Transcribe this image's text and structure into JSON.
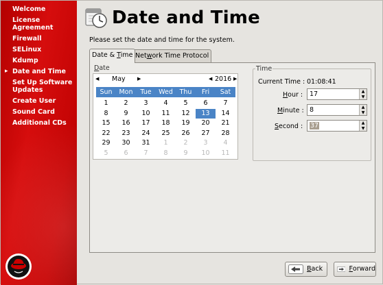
{
  "sidebar": {
    "items": [
      {
        "label": "Welcome"
      },
      {
        "label": "License Agreement"
      },
      {
        "label": "Firewall"
      },
      {
        "label": "SELinux"
      },
      {
        "label": "Kdump"
      },
      {
        "label": "Date and Time",
        "current": true
      },
      {
        "label": "Set Up Software Updates"
      },
      {
        "label": "Create User"
      },
      {
        "label": "Sound Card"
      },
      {
        "label": "Additional CDs"
      }
    ],
    "current_marker": "▸"
  },
  "header": {
    "title": "Date and Time",
    "instructions": "Please set the date and time for the system."
  },
  "tabs": [
    {
      "label_pre": "Date & ",
      "label_mnemonic": "T",
      "label_post": "ime",
      "active": true
    },
    {
      "label_pre": "Net",
      "label_mnemonic": "w",
      "label_post": "ork Time Protocol",
      "active": false
    }
  ],
  "date_group": {
    "label_pre": "",
    "label_mnemonic": "D",
    "label_post": "ate",
    "month": "May",
    "year": "2016",
    "weekdays": [
      "Sun",
      "Mon",
      "Tue",
      "Wed",
      "Thu",
      "Fri",
      "Sat"
    ],
    "weeks": [
      [
        {
          "d": "1"
        },
        {
          "d": "2"
        },
        {
          "d": "3"
        },
        {
          "d": "4"
        },
        {
          "d": "5"
        },
        {
          "d": "6"
        },
        {
          "d": "7"
        }
      ],
      [
        {
          "d": "8"
        },
        {
          "d": "9"
        },
        {
          "d": "10"
        },
        {
          "d": "11"
        },
        {
          "d": "12"
        },
        {
          "d": "13",
          "sel": true
        },
        {
          "d": "14"
        }
      ],
      [
        {
          "d": "15"
        },
        {
          "d": "16"
        },
        {
          "d": "17"
        },
        {
          "d": "18"
        },
        {
          "d": "19"
        },
        {
          "d": "20"
        },
        {
          "d": "21"
        }
      ],
      [
        {
          "d": "22"
        },
        {
          "d": "23"
        },
        {
          "d": "24"
        },
        {
          "d": "25"
        },
        {
          "d": "26"
        },
        {
          "d": "27"
        },
        {
          "d": "28"
        }
      ],
      [
        {
          "d": "29"
        },
        {
          "d": "30"
        },
        {
          "d": "31"
        },
        {
          "d": "1",
          "other": true
        },
        {
          "d": "2",
          "other": true
        },
        {
          "d": "3",
          "other": true
        },
        {
          "d": "4",
          "other": true
        }
      ],
      [
        {
          "d": "5",
          "other": true
        },
        {
          "d": "6",
          "other": true
        },
        {
          "d": "7",
          "other": true
        },
        {
          "d": "8",
          "other": true
        },
        {
          "d": "9",
          "other": true
        },
        {
          "d": "10",
          "other": true
        },
        {
          "d": "11",
          "other": true
        }
      ]
    ]
  },
  "time_group": {
    "label": "Time",
    "current_time_label": "Current Time :",
    "current_time_value": "01:08:41",
    "hour": {
      "label_pre": "",
      "label_mnemonic": "H",
      "label_post": "our :",
      "value": "17"
    },
    "minute": {
      "label_pre": "",
      "label_mnemonic": "M",
      "label_post": "inute :",
      "value": "8"
    },
    "second": {
      "label_pre": "",
      "label_mnemonic": "S",
      "label_post": "econd :",
      "value": "37"
    }
  },
  "buttons": {
    "back": {
      "label_pre": "",
      "label_mnemonic": "B",
      "label_post": "ack"
    },
    "forward": {
      "label_pre": "",
      "label_mnemonic": "F",
      "label_post": "orward"
    }
  },
  "colors": {
    "sidebar_red": "#c40404",
    "selection_blue": "#4a84c6"
  }
}
